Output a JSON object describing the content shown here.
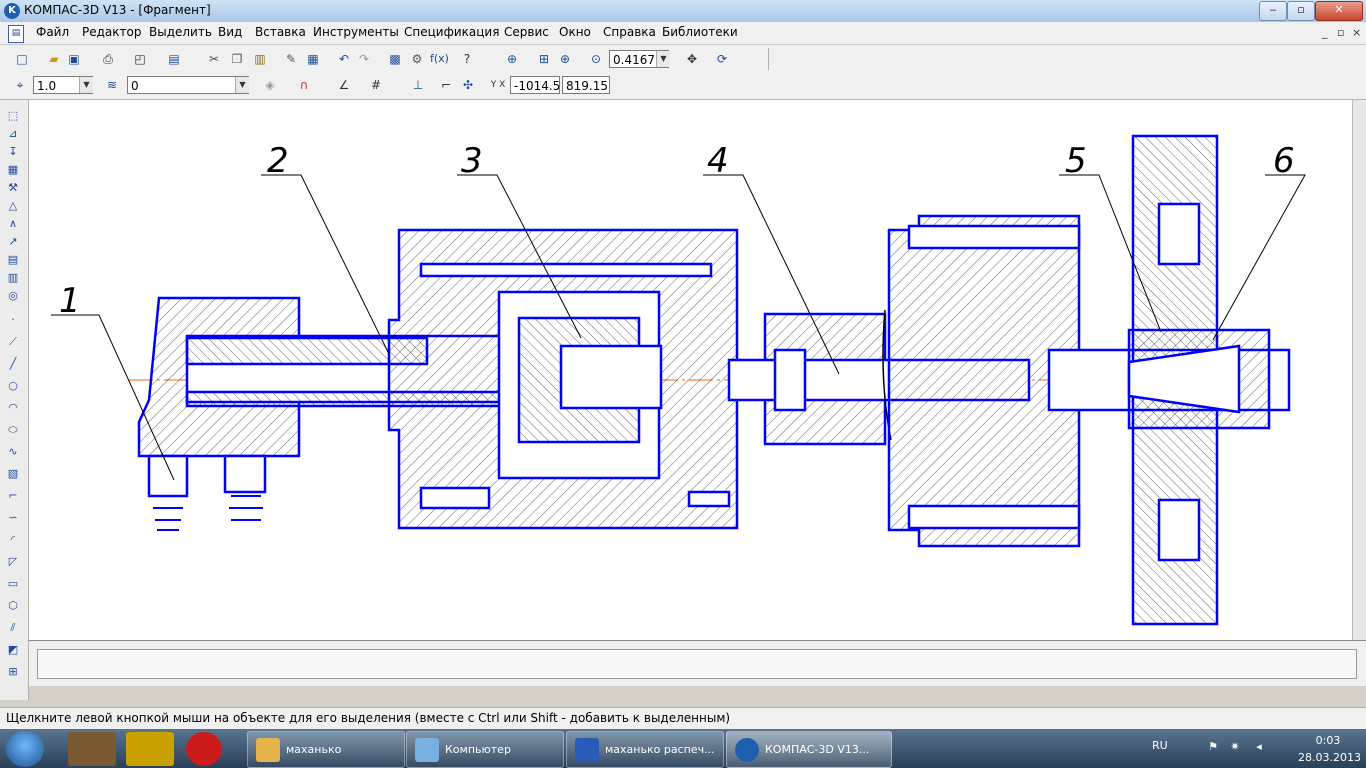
{
  "window": {
    "title": "КОМПАС-3D V13 - [Фрагмент]",
    "app_icon": "kompas-logo-icon",
    "controls": {
      "minimize": "‒",
      "maximize": "▫",
      "close": "✕"
    }
  },
  "menu": {
    "items": [
      "Файл",
      "Редактор",
      "Выделить",
      "Вид",
      "Вставка",
      "Инструменты",
      "Спецификация",
      "Сервис",
      "Окно",
      "Справка",
      "Библиотеки"
    ],
    "mdi_controls": [
      "_",
      "▫",
      "×"
    ]
  },
  "toolbar_main": {
    "zoom_value": "0.4167"
  },
  "toolbar_current_state": {
    "step_value": "1.0",
    "layer_value": "0",
    "coord_x": "-1014.5",
    "coord_y": "819.15"
  },
  "drawing": {
    "callouts": [
      "1",
      "2",
      "3",
      "4",
      "5",
      "6"
    ],
    "line_color": "#0000ff",
    "axis_color": "#ff6600"
  },
  "statusbar": {
    "text": "Щелкните левой кнопкой мыши на объекте для его выделения (вместе с Ctrl или Shift - добавить к выделенным)"
  },
  "taskbar": {
    "tasks": [
      "маханько",
      "Компьютер",
      "маханько распеч...",
      "КОМПАС-3D V13..."
    ],
    "language": "RU",
    "time": "0:03",
    "date": "28.03.2013"
  }
}
